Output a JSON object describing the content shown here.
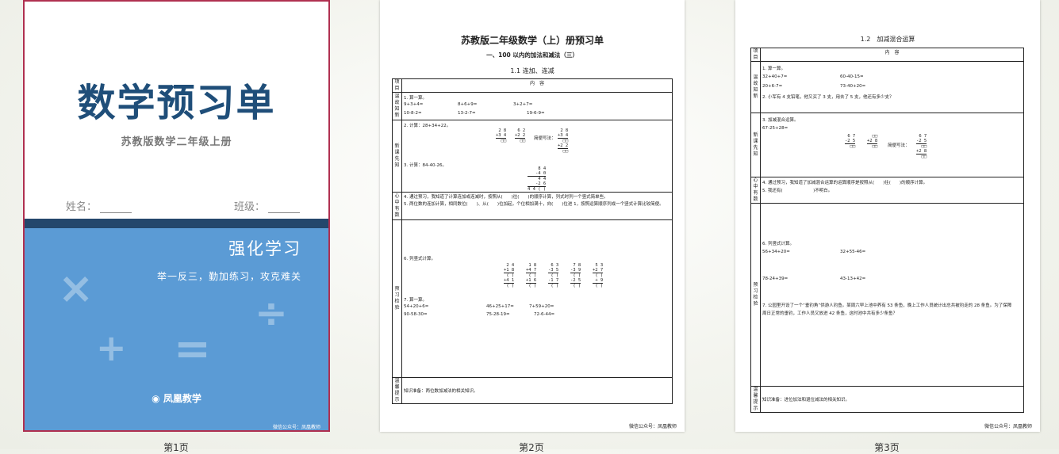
{
  "cover": {
    "title": "数学预习单",
    "subtitle": "苏教版数学二年级上册",
    "name_label": "姓名：",
    "class_label": "班级：",
    "strong_heading": "强化学习",
    "slogan": "举一反三，勤加练习，攻克难关",
    "symbols": [
      "×",
      "÷",
      "+",
      "="
    ],
    "brand": "凤凰教学",
    "footer": "微信公众号：凤凰教师"
  },
  "page2": {
    "title": "苏教版二年级数学（上）册预习单",
    "subtitle": "一、100 以内的加法和减法（三）",
    "section": "1.1  连加、连减",
    "header_left": "项目",
    "header_right": "内　容",
    "rows": {
      "review_label": "温故知新",
      "review_lines": [
        "1. 算一算。",
        "9+3+4=",
        "8+6+9=",
        "3+2+7=",
        "10-8-2=",
        "13-2-7=",
        "19-6-9="
      ],
      "new_label": "新课先知",
      "new_q2": "2. 计算：28+34+22。",
      "new_simple": "简便写法：",
      "new_q3": "3. 计算：84-40-26。",
      "vert1": [
        "2 8",
        "+3 4",
        "□□"
      ],
      "vert2": [
        "6 2",
        "+2 2",
        "□□"
      ],
      "vert3": [
        "2 8",
        "+3 4",
        "□□",
        "+2 2",
        "□□"
      ],
      "vert4": [
        "8 4",
        "-4 0",
        "4 4",
        "-2 6",
        "4 4 (  )"
      ],
      "insight_label": "心中有数",
      "insight_lines": [
        "4. 通过预习，我知道了计算连加或连减时，按照从(　　)往(　　)的顺序计算，列式时列一个竖式简单些。",
        "5. 两位数的连加计算，相同数位(　　)、从(　　)位加起，个位相加满十，向(　　)位进 1，按照运算顺序列成一个竖式计算比较简便。"
      ],
      "check_label": "预习检验",
      "check_q6": "6. 列竖式计算。",
      "check_q7": "7. 算一算。",
      "check_lines": [
        "54+20+6=",
        "46+25+17=",
        "7+59+20=",
        "90-58-30=",
        "75-28-19=",
        "72-6-44="
      ],
      "tip_label": "温馨提示",
      "tip": "知识准备：两位数加减法的相关知识。"
    },
    "footer": "微信公众号：凤凰教师"
  },
  "page3": {
    "title": "1.2　加减混合运算",
    "header_left": "项目",
    "header_right": "内　容",
    "rows": {
      "review_label": "温故知新",
      "review_lines": [
        "1. 算一算。",
        "32+40+7=",
        "60-40-15=",
        "20+6-7=",
        "73-40+20=",
        "2. 小军有 4 支铅笔，他又买了 3 支，用去了 5 支，他还有多少支？"
      ],
      "new_label": "新课先知",
      "new_q3": "3. 加减混合运算。",
      "new_expr": "67-25+28=",
      "new_simple": "简便写法：",
      "insight_label": "心中有数",
      "insight_lines": [
        "4. 通过预习，我知道了加减混合运算的运算顺序是按照从(　　)往(　　)的顺序计算。",
        "5. 我还有(　　　　　　　)不明白。"
      ],
      "check_label": "预习检验",
      "check_q6": "6. 列竖式计算。",
      "check_lines": [
        "56+34+20=",
        "32+55-46=",
        "78-24+39=",
        "43-13+42="
      ],
      "check_q7": "7. 公园里开设了一个“垂钓角”供游人钓鱼。某周六早上池中养有 53 条鱼，晚上工作人员统计出总共被钓走的 28 条鱼。为了保障周日正常的垂钓，工作人员又放进 42 条鱼，这时池中共有多少条鱼？",
      "tip_label": "温馨提示",
      "tip": "知识准备：进位加法和退位减法的相关知识。"
    },
    "footer": "微信公众号：凤凰教师"
  },
  "page_labels": [
    "第1页",
    "第2页",
    "第3页"
  ]
}
